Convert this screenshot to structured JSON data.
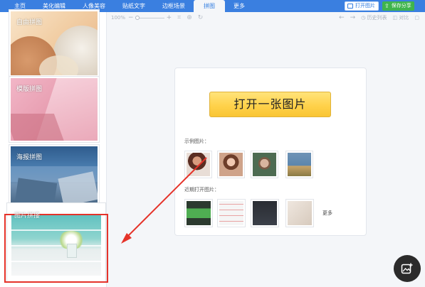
{
  "topbar": {
    "tabs": [
      {
        "label": "主页"
      },
      {
        "label": "美化编辑"
      },
      {
        "label": "人像美容"
      },
      {
        "label": "贴纸文字"
      },
      {
        "label": "边框场景"
      },
      {
        "label": "拼图"
      },
      {
        "label": "更多"
      }
    ],
    "active_tab": "拼图",
    "open_label": "打开图片",
    "save_label": "保存分享",
    "colors": {
      "bar": "#3a7fe0",
      "save": "#3fb44d"
    }
  },
  "toolbar": {
    "zoom": "100%",
    "minus": "−",
    "plus": "+",
    "history_label": "历史列表",
    "compare_label": "对比"
  },
  "sidebar": {
    "items": [
      {
        "label": "自由拼图"
      },
      {
        "label": "模版拼图"
      },
      {
        "label": "海报拼图"
      },
      {
        "label": "图片拼接"
      }
    ],
    "highlight_color": "#e5332a"
  },
  "main": {
    "open_button": "打开一张图片",
    "samples_label": "示例图片：",
    "recent_label": "近期打开图片：",
    "more_label": "更多"
  }
}
